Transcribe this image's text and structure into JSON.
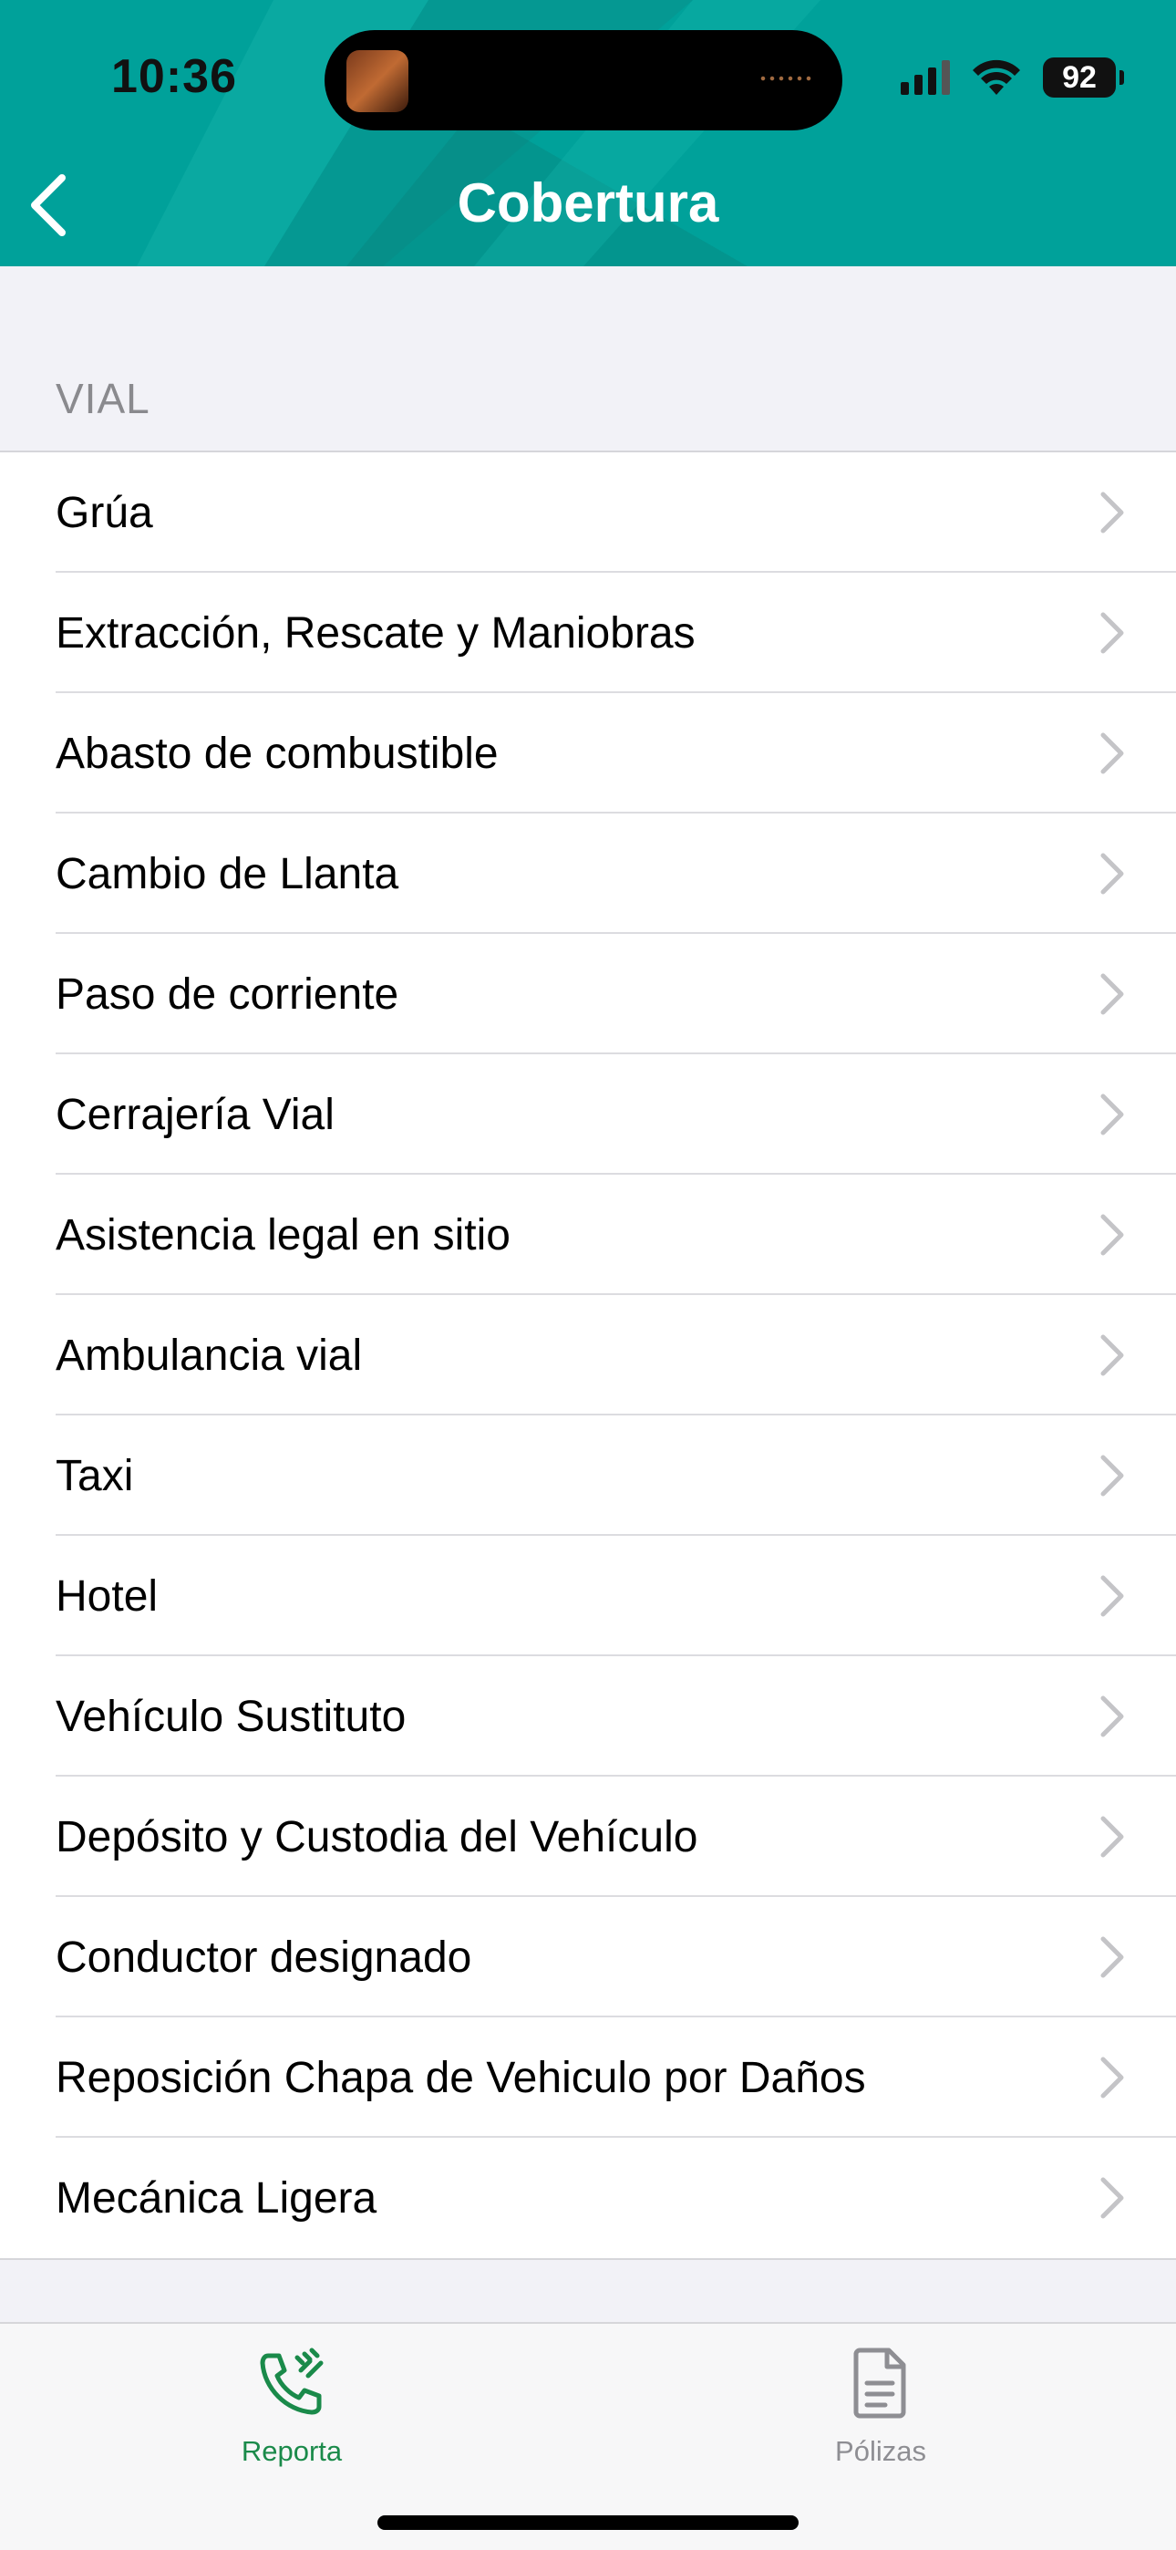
{
  "status_bar": {
    "time": "10:36",
    "battery": "92",
    "icons": [
      "cellular-signal-icon",
      "wifi-icon",
      "battery-icon"
    ]
  },
  "nav": {
    "title": "Cobertura",
    "back_icon": "chevron-left-icon"
  },
  "section": {
    "title": "VIAL"
  },
  "items": [
    {
      "label": "Grúa"
    },
    {
      "label": "Extracción, Rescate y Maniobras"
    },
    {
      "label": "Abasto de combustible"
    },
    {
      "label": "Cambio de Llanta"
    },
    {
      "label": "Paso de corriente"
    },
    {
      "label": "Cerrajería Vial"
    },
    {
      "label": "Asistencia legal en sitio"
    },
    {
      "label": "Ambulancia vial"
    },
    {
      "label": "Taxi"
    },
    {
      "label": "Hotel"
    },
    {
      "label": "Vehículo Sustituto"
    },
    {
      "label": "Depósito y Custodia del Vehículo"
    },
    {
      "label": "Conductor designado"
    },
    {
      "label": "Reposición Chapa de Vehiculo por Daños"
    },
    {
      "label": "Mecánica Ligera"
    }
  ],
  "tabbar": {
    "tabs": [
      {
        "label": "Reporta",
        "icon": "phone-call-icon",
        "active": true
      },
      {
        "label": "Pólizas",
        "icon": "document-icon",
        "active": false
      }
    ]
  },
  "colors": {
    "brand": "#00a19a",
    "active_tab": "#1a8a4a",
    "inactive_tab": "#8e8e93",
    "chevron": "#c4c4c7"
  }
}
